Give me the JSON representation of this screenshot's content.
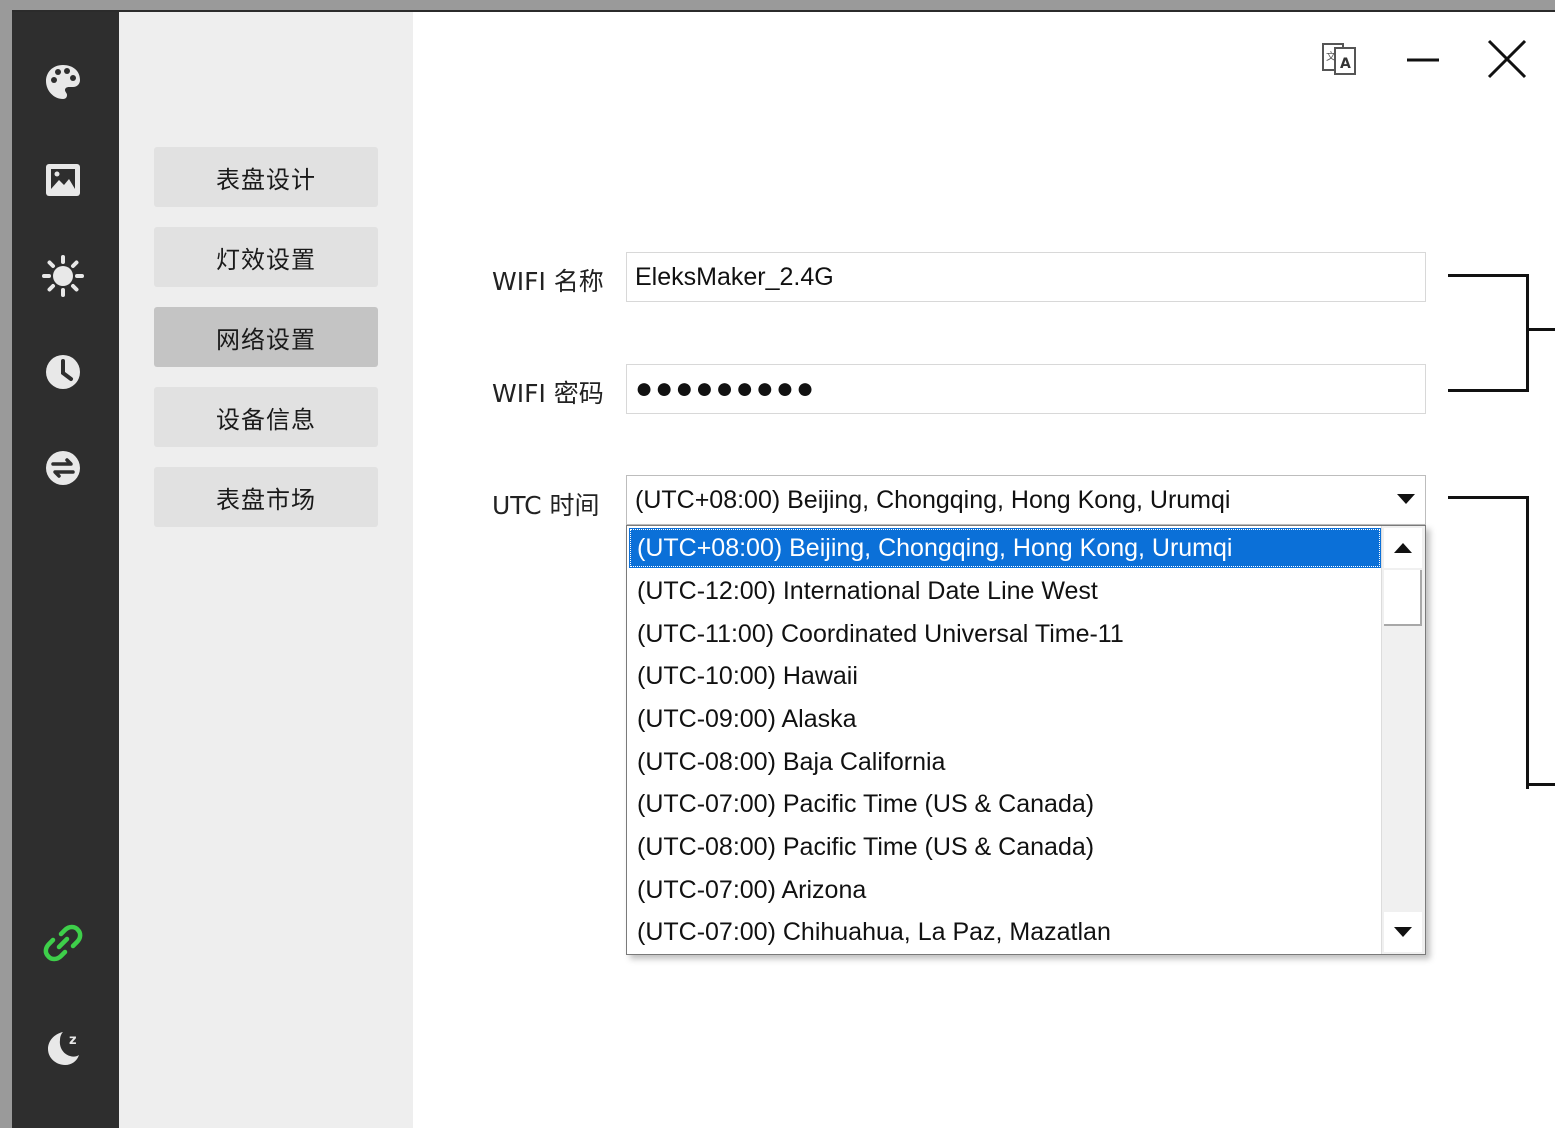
{
  "sidebar": {
    "icons": [
      {
        "name": "palette-icon"
      },
      {
        "name": "image-icon"
      },
      {
        "name": "brightness-icon"
      },
      {
        "name": "clock-icon"
      },
      {
        "name": "transfer-icon"
      },
      {
        "name": "link-icon",
        "color": "#3ecf4a"
      },
      {
        "name": "sleep-icon"
      }
    ]
  },
  "menu": {
    "items": [
      {
        "label": "表盘设计"
      },
      {
        "label": "灯效设置"
      },
      {
        "label": "网络设置"
      },
      {
        "label": "设备信息"
      },
      {
        "label": "表盘市场"
      }
    ],
    "active_index": 2
  },
  "titlebar": {
    "icons": [
      "language-icon",
      "minimize-icon",
      "close-icon"
    ]
  },
  "form": {
    "wifi_name_label": "WIFI 名称",
    "wifi_name_value": "EleksMaker_2.4G",
    "wifi_password_label": "WIFI 密码",
    "wifi_password_value": "●●●●●●●●●",
    "utc_label": "UTC 时间",
    "utc_value": "(UTC+08:00) Beijing, Chongqing, Hong Kong, Urumqi"
  },
  "dropdown": {
    "options": [
      "(UTC+08:00) Beijing, Chongqing, Hong Kong, Urumqi",
      "(UTC-12:00) International Date Line West",
      "(UTC-11:00) Coordinated Universal Time-11",
      "(UTC-10:00) Hawaii",
      "(UTC-09:00) Alaska",
      "(UTC-08:00) Baja California",
      "(UTC-07:00) Pacific Time (US & Canada)",
      "(UTC-08:00) Pacific Time (US & Canada)",
      "(UTC-07:00) Arizona",
      "(UTC-07:00) Chihuahua, La Paz, Mazatlan"
    ],
    "selected_index": 0,
    "selected_color": "#0b70d8"
  }
}
